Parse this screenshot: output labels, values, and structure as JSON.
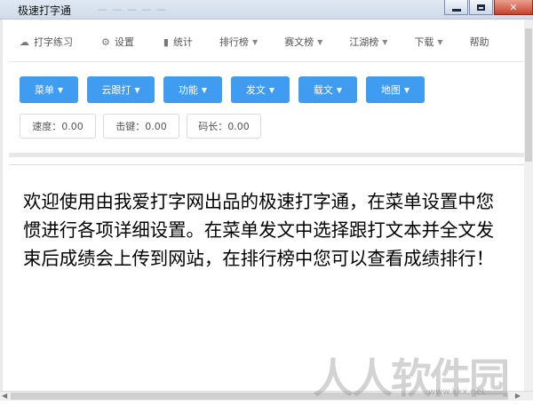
{
  "window": {
    "title": "极速打字通",
    "ghost_title": "— — — — —",
    "min_label": "",
    "max_label": "",
    "close_label": "✕"
  },
  "menu": [
    {
      "icon": "cloud-icon",
      "glyph": "☁",
      "label": "打字练习",
      "caret": false
    },
    {
      "icon": "gear-icon",
      "glyph": "⚙",
      "label": "设置",
      "caret": false
    },
    {
      "icon": "bar-chart-icon",
      "glyph": "▮",
      "label": "统计",
      "caret": false
    },
    {
      "icon": "",
      "glyph": "",
      "label": "排行榜",
      "caret": true
    },
    {
      "icon": "",
      "glyph": "",
      "label": "赛文榜",
      "caret": true
    },
    {
      "icon": "",
      "glyph": "",
      "label": "江湖榜",
      "caret": true
    },
    {
      "icon": "",
      "glyph": "",
      "label": "下载",
      "caret": true
    },
    {
      "icon": "",
      "glyph": "",
      "label": "帮助",
      "caret": false
    }
  ],
  "buttons": [
    {
      "label": "菜单"
    },
    {
      "label": "云跟打"
    },
    {
      "label": "功能"
    },
    {
      "label": "发文"
    },
    {
      "label": "载文"
    },
    {
      "label": "地图"
    }
  ],
  "stats": [
    {
      "label": "速度：0.00"
    },
    {
      "label": "击键：0.00"
    },
    {
      "label": "码长：0.00"
    }
  ],
  "progress": 0,
  "text_lines": [
    "欢迎使用由我爱打字网出品的极速打字通，在菜单设置中您",
    "惯进行各项详细设置。在菜单发文中选择跟打文本并全文发",
    "束后成绩会上传到网站，在排行榜中您可以查看成绩排行！"
  ],
  "watermark": {
    "main": "人人软件园",
    "sub": "www.kkx.net"
  },
  "colors": {
    "button_blue": "#3f9cf0",
    "close_red": "#c8402b"
  }
}
